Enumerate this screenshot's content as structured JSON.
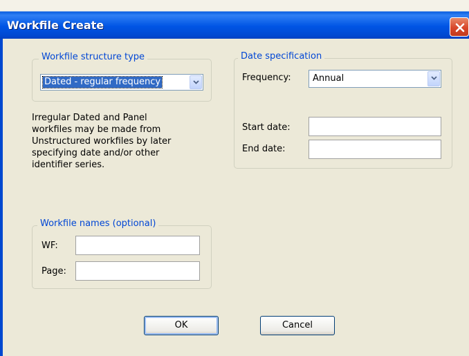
{
  "window": {
    "title": "Workfile Create"
  },
  "structure_group": {
    "legend": "Workfile structure type",
    "selected": "Dated - regular frequency",
    "info_text": "Irregular Dated and Panel\nworkfiles may be made from\nUnstructured workfiles by later\nspecifying date and/or other\nidentifier series."
  },
  "date_group": {
    "legend": "Date specification",
    "frequency_label": "Frequency:",
    "frequency_value": "Annual",
    "start_label": "Start date:",
    "start_value": "",
    "end_label": "End date:",
    "end_value": ""
  },
  "names_group": {
    "legend": "Workfile names (optional)",
    "wf_label": "WF:",
    "wf_value": "",
    "page_label": "Page:",
    "page_value": ""
  },
  "buttons": {
    "ok": "OK",
    "cancel": "Cancel"
  },
  "icons": {
    "close": "close-icon",
    "dropdown": "chevron-down-icon"
  },
  "colors": {
    "titlebar": "#0055e5",
    "legend_text": "#0046d5",
    "selection": "#316ac5",
    "close": "#d8472a"
  }
}
